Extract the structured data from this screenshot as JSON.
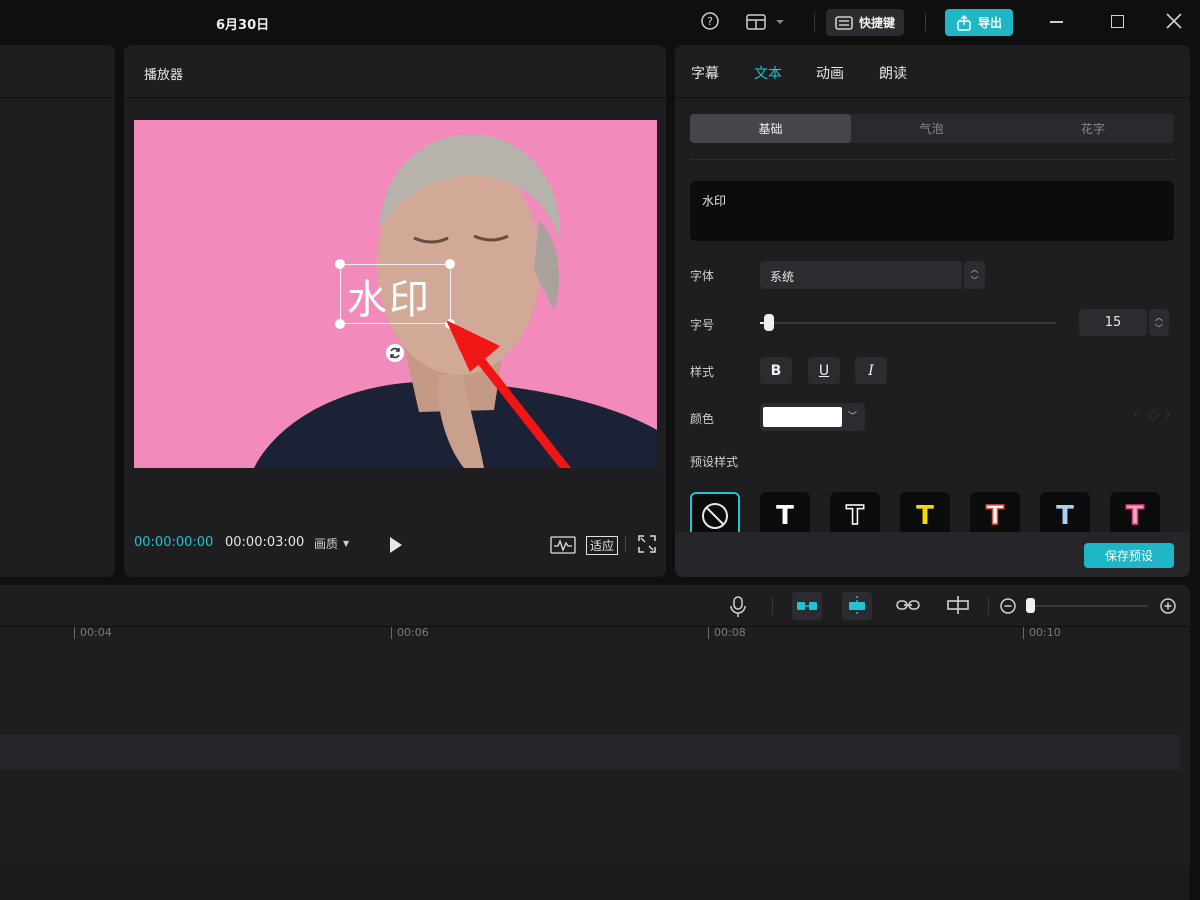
{
  "titlebar": {
    "title": "6月30日",
    "shortcut_label": "快捷键",
    "export_label": "导出"
  },
  "player": {
    "title": "播放器",
    "watermark_text": "水印",
    "current_time": "00:00:00:00",
    "total_time": "00:00:03:00",
    "quality_label": "画质",
    "fit_label": "适应"
  },
  "inspector": {
    "tabs": [
      {
        "label": "字幕"
      },
      {
        "label": "文本"
      },
      {
        "label": "动画"
      },
      {
        "label": "朗读"
      }
    ],
    "subtabs": [
      {
        "label": "基础"
      },
      {
        "label": "气泡"
      },
      {
        "label": "花字"
      }
    ],
    "text_value": "水印",
    "font_label": "字体",
    "font_value": "系统",
    "size_label": "字号",
    "size_value": "15",
    "style_label": "样式",
    "style_bold": "B",
    "style_underline": "U",
    "style_italic": "I",
    "color_label": "颜色",
    "color_value": "#ffffff",
    "preset_label": "预设样式",
    "save_preset_label": "保存预设",
    "preset_glyph": "T"
  },
  "timeline": {
    "ticks": [
      "00:04",
      "00:06",
      "00:08",
      "00:10"
    ]
  },
  "colors": {
    "accent": "#1fc3d3",
    "video_background": "#f28bbb"
  }
}
